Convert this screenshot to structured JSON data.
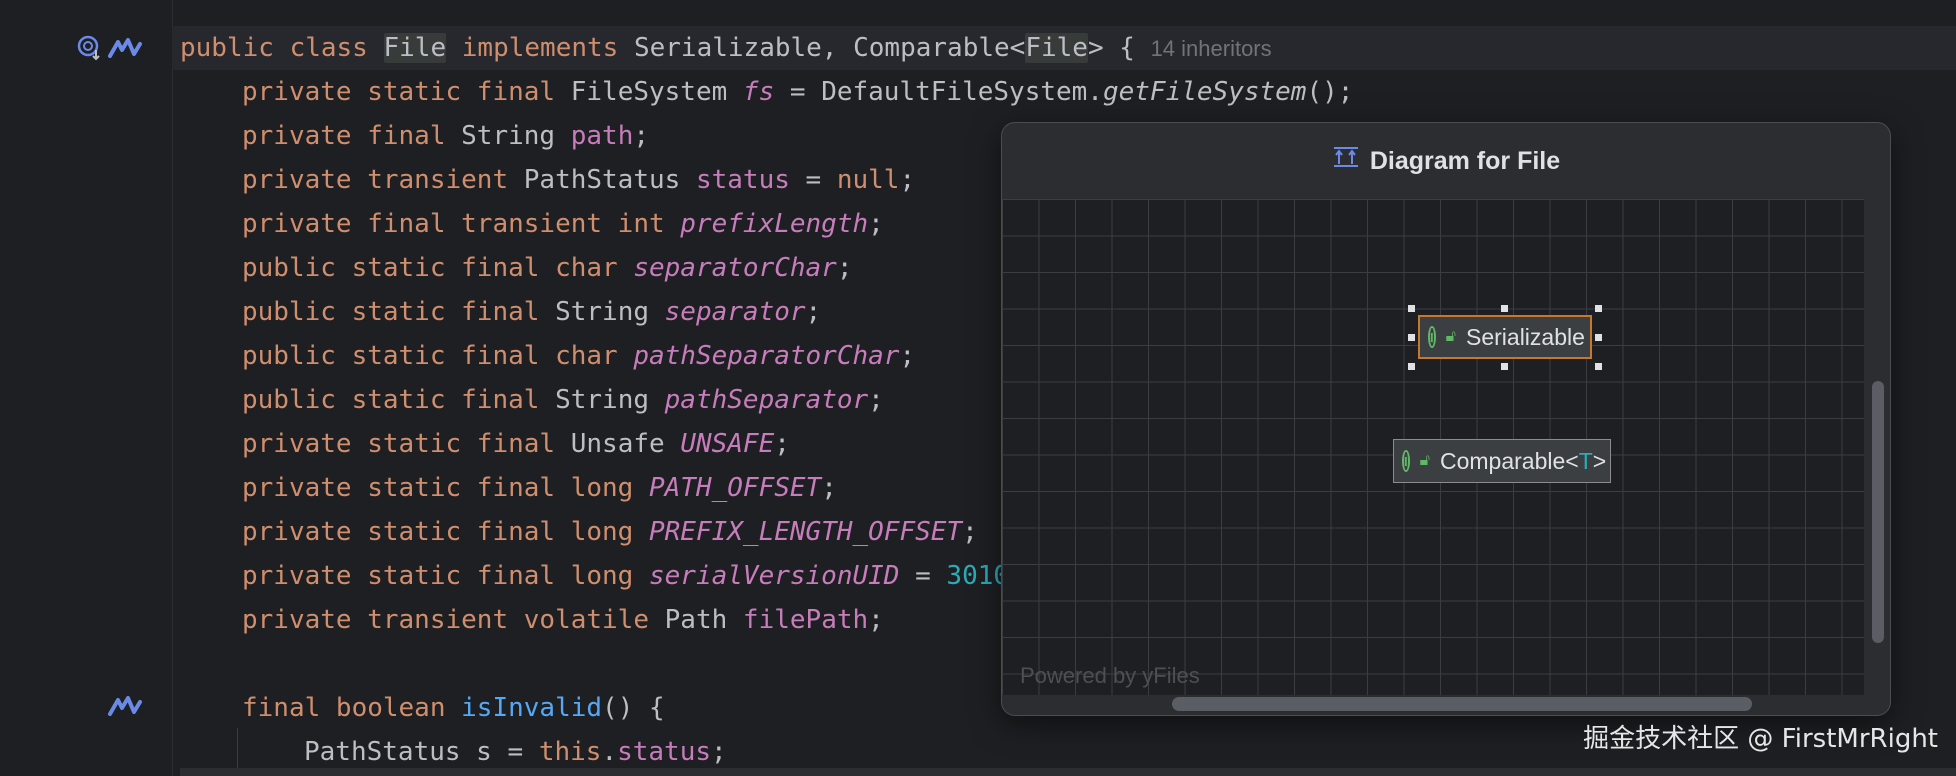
{
  "editor": {
    "inheritors_hint": "14 inheritors",
    "lines": [
      {
        "tokens": [
          [
            "kw",
            "public class "
          ],
          [
            "hl",
            "File"
          ],
          [
            "kw",
            " implements "
          ],
          [
            "txt",
            "Serializable, Comparable<"
          ],
          [
            "hl",
            "File"
          ],
          [
            "txt",
            "> { "
          ]
        ]
      },
      {
        "tokens": [
          [
            "kw",
            "private static final "
          ],
          [
            "txt",
            "FileSystem "
          ],
          [
            "static",
            "fs"
          ],
          [
            "txt",
            " = DefaultFileSystem."
          ],
          [
            "ital",
            "getFileSystem"
          ],
          [
            "txt",
            "();"
          ]
        ]
      },
      {
        "tokens": [
          [
            "kw",
            "private final "
          ],
          [
            "txt",
            "String "
          ],
          [
            "field",
            "path"
          ],
          [
            "txt",
            ";"
          ]
        ]
      },
      {
        "tokens": [
          [
            "kw",
            "private transient "
          ],
          [
            "txt",
            "PathStatus "
          ],
          [
            "field",
            "status"
          ],
          [
            "txt",
            " = "
          ],
          [
            "kw",
            "null"
          ],
          [
            "txt",
            ";"
          ]
        ]
      },
      {
        "tokens": [
          [
            "kw",
            "private final transient int "
          ],
          [
            "static",
            "prefixLength"
          ],
          [
            "txt",
            ";"
          ]
        ]
      },
      {
        "tokens": [
          [
            "kw",
            "public static final char "
          ],
          [
            "static",
            "separatorChar"
          ],
          [
            "txt",
            ";"
          ]
        ]
      },
      {
        "tokens": [
          [
            "kw",
            "public static final "
          ],
          [
            "txt",
            "String "
          ],
          [
            "static",
            "separator"
          ],
          [
            "txt",
            ";"
          ]
        ]
      },
      {
        "tokens": [
          [
            "kw",
            "public static final char "
          ],
          [
            "static",
            "pathSeparatorChar"
          ],
          [
            "txt",
            ";"
          ]
        ]
      },
      {
        "tokens": [
          [
            "kw",
            "public static final "
          ],
          [
            "txt",
            "String "
          ],
          [
            "static",
            "pathSeparator"
          ],
          [
            "txt",
            ";"
          ]
        ]
      },
      {
        "tokens": [
          [
            "kw",
            "private static final "
          ],
          [
            "txt",
            "Unsafe "
          ],
          [
            "static",
            "UNSAFE"
          ],
          [
            "txt",
            ";"
          ]
        ]
      },
      {
        "tokens": [
          [
            "kw",
            "private static final long "
          ],
          [
            "static",
            "PATH_OFFSET"
          ],
          [
            "txt",
            ";"
          ]
        ]
      },
      {
        "tokens": [
          [
            "kw",
            "private static final long "
          ],
          [
            "static",
            "PREFIX_LENGTH_OFFSET"
          ],
          [
            "txt",
            ";"
          ]
        ]
      },
      {
        "tokens": [
          [
            "kw",
            "private static final long "
          ],
          [
            "static",
            "serialVersionUID"
          ],
          [
            "txt",
            " = "
          ],
          [
            "num",
            "3010"
          ]
        ]
      },
      {
        "tokens": [
          [
            "kw",
            "private transient volatile "
          ],
          [
            "txt",
            "Path "
          ],
          [
            "field",
            "filePath"
          ],
          [
            "txt",
            ";"
          ]
        ]
      },
      {
        "tokens": []
      },
      {
        "tokens": [
          [
            "kw",
            "final boolean "
          ],
          [
            "method",
            "isInvalid"
          ],
          [
            "txt",
            "() {"
          ]
        ]
      },
      {
        "tokens": [
          [
            "txt",
            "PathStatus s = "
          ],
          [
            "kw",
            "this"
          ],
          [
            "txt",
            "."
          ],
          [
            "field",
            "status"
          ],
          [
            "txt",
            ";"
          ]
        ]
      }
    ]
  },
  "popup": {
    "title": "Diagram for File",
    "powered_by": "Powered by yFiles",
    "nodes": {
      "serializable": {
        "label": "Serializable"
      },
      "comparable": {
        "label": "Comparable",
        "type_param": "T"
      }
    }
  },
  "icons": {
    "gutter_implemented": "implemented-interface-icon",
    "gutter_ai": "ai-assistant-icon",
    "diagram": "diagram-icon",
    "interface": "interface-icon",
    "visibility": "public-lock-icon"
  },
  "watermark": "掘金技术社区 @ FirstMrRight"
}
